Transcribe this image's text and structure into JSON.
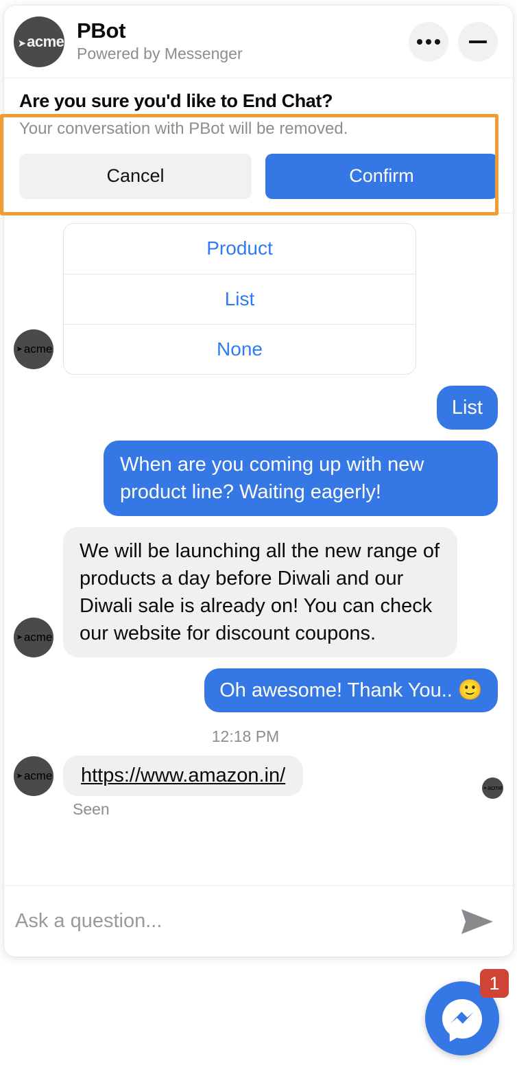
{
  "header": {
    "avatar_label": "acme",
    "avatar_tick": "➤",
    "bot_name": "PBot",
    "subtitle": "Powered by Messenger",
    "more_icon": "more-options-icon",
    "minimize_icon": "minimize-icon"
  },
  "end_chat": {
    "title": "Are you sure you'd like to End Chat?",
    "subtitle": "Your conversation with PBot will be removed.",
    "cancel_label": "Cancel",
    "confirm_label": "Confirm",
    "highlight_color": "#ef9c32"
  },
  "quick_replies": {
    "options": [
      {
        "label": "Product"
      },
      {
        "label": "List"
      },
      {
        "label": "None"
      }
    ]
  },
  "messages": [
    {
      "id": "m1",
      "from": "user",
      "text": "List"
    },
    {
      "id": "m2",
      "from": "user",
      "text": "When are you coming up with new product line? Waiting eagerly!"
    },
    {
      "id": "m3",
      "from": "bot",
      "text": "We will be launching all the new range of products a day before Diwali and our Diwali sale is already on! You can check our website for discount coupons."
    },
    {
      "id": "m4",
      "from": "user",
      "text": "Oh awesome! Thank You.. 🙂"
    }
  ],
  "timestamp": "12:18 PM",
  "link_message": {
    "url_text": "https://www.amazon.in/",
    "seen_label": "Seen"
  },
  "composer": {
    "placeholder": "Ask a question...",
    "value": "",
    "send_icon": "send-icon"
  },
  "launcher": {
    "icon": "messenger-icon",
    "badge_count": "1",
    "brand_color": "#3578e5",
    "badge_color": "#cf4436"
  },
  "colors": {
    "outgoing_bubble": "#3578e5",
    "incoming_bubble": "#f0f0f0",
    "link_blue": "#2f7bf6",
    "muted_text": "#8d8d8d"
  }
}
